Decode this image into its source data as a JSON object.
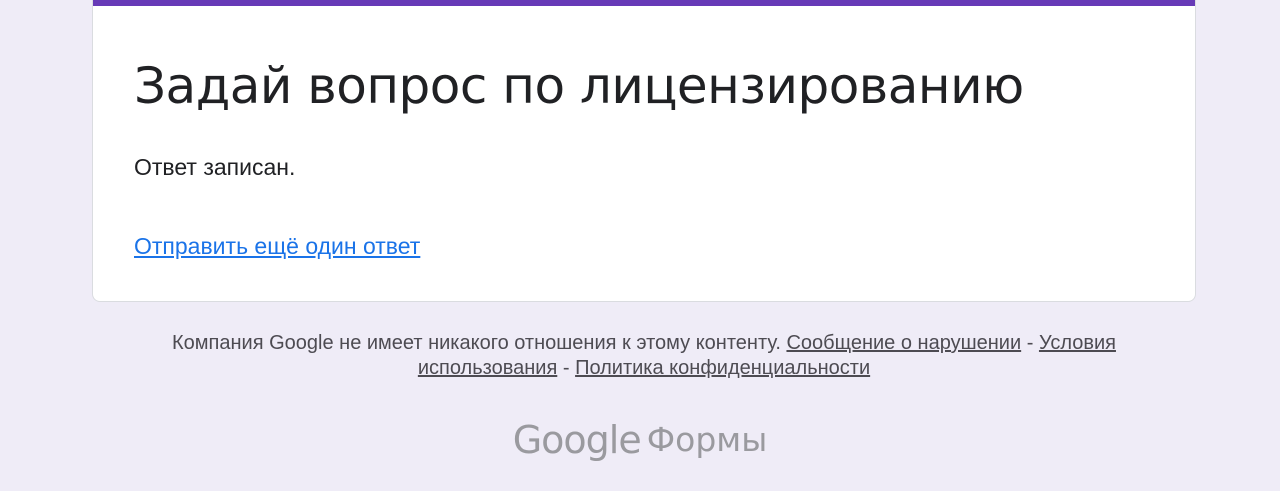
{
  "colors": {
    "page_background": "#efecf7",
    "accent": "#673ab7",
    "link": "#1a73e8",
    "text": "#202124",
    "footer_text": "#4d4b52",
    "brand": "#9a9a9f"
  },
  "form": {
    "title": "Задай вопрос по лицензированию",
    "confirmation": "Ответ записан.",
    "submit_another_label": "Отправить ещё один ответ"
  },
  "footer": {
    "disclaimer": "Компания Google не имеет никакого отношения к этому контенту.",
    "report_abuse_label": "Сообщение о нарушении",
    "separator_1": "-",
    "terms_label": "Условия использования",
    "separator_2": "-",
    "privacy_label": "Политика конфиденциальности"
  },
  "branding": {
    "google": "Google",
    "product": "Формы"
  }
}
